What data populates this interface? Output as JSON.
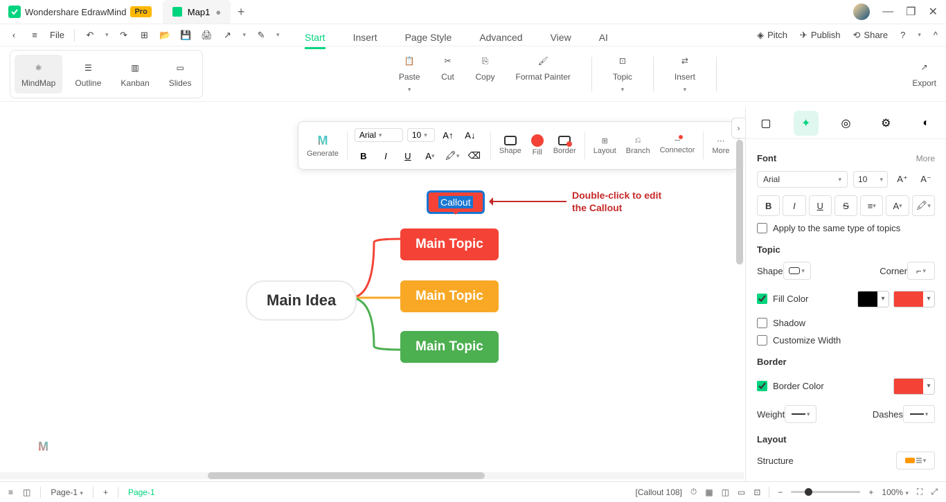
{
  "titlebar": {
    "app_name": "Wondershare EdrawMind",
    "pro": "Pro",
    "doc_name": "Map1"
  },
  "quickbar": {
    "file": "File",
    "pitch": "Pitch",
    "publish": "Publish",
    "share": "Share"
  },
  "menu": {
    "start": "Start",
    "insert": "Insert",
    "page_style": "Page Style",
    "advanced": "Advanced",
    "view": "View",
    "ai": "AI"
  },
  "views": {
    "mindmap": "MindMap",
    "outline": "Outline",
    "kanban": "Kanban",
    "slides": "Slides"
  },
  "ribbon": {
    "paste": "Paste",
    "cut": "Cut",
    "copy": "Copy",
    "format_painter": "Format Painter",
    "topic": "Topic",
    "insert": "Insert",
    "export": "Export"
  },
  "float": {
    "generate": "Generate",
    "font": "Arial",
    "size": "10",
    "shape": "Shape",
    "fill": "Fill",
    "border": "Border",
    "layout": "Layout",
    "branch": "Branch",
    "connector": "Connector",
    "more": "More"
  },
  "map": {
    "main_idea": "Main Idea",
    "topic1": "Main Topic",
    "topic2": "Main Topic",
    "topic3": "Main Topic",
    "callout": "Callout"
  },
  "annotation": {
    "line1": "Double-click to edit",
    "line2": "the Callout"
  },
  "panel": {
    "font_head": "Font",
    "more": "More",
    "font_family": "Arial",
    "font_size": "10",
    "apply_same": "Apply to the same type of topics",
    "topic_head": "Topic",
    "shape": "Shape",
    "corner": "Corner",
    "fill_color": "Fill Color",
    "shadow": "Shadow",
    "customize_width": "Customize Width",
    "border_head": "Border",
    "border_color": "Border Color",
    "weight": "Weight",
    "dashes": "Dashes",
    "layout_head": "Layout",
    "structure": "Structure"
  },
  "status": {
    "page_name": "Page-1",
    "active_page": "Page-1",
    "selection": "[Callout 108]",
    "zoom": "100%"
  },
  "colors": {
    "red": "#f44336",
    "black": "#000000"
  }
}
